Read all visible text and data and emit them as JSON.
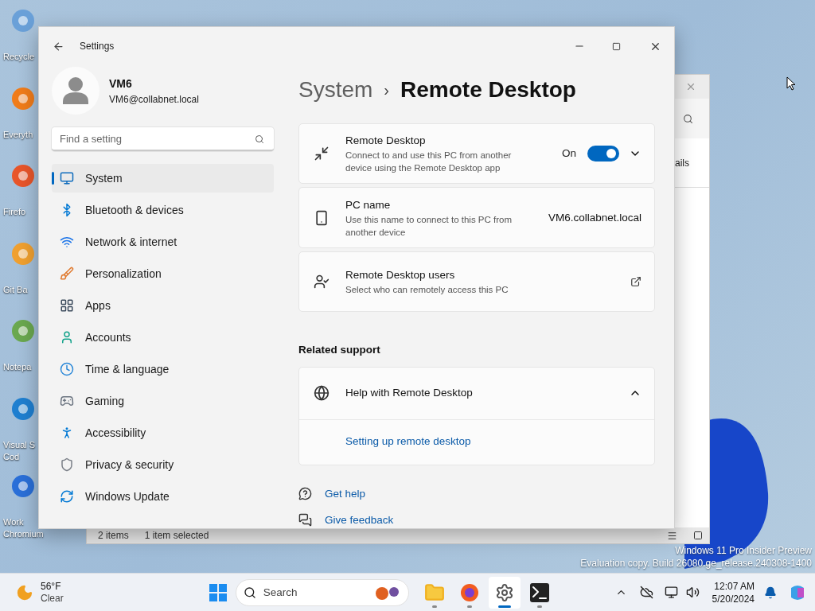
{
  "desktop_icons": [
    {
      "lines": [
        "Recycle"
      ]
    },
    {
      "lines": [
        "Everyth"
      ]
    },
    {
      "lines": [
        "Firefo"
      ]
    },
    {
      "lines": [
        "Git Ba"
      ]
    },
    {
      "lines": [
        "Notepa"
      ]
    },
    {
      "lines": [
        "Visual S",
        "Cod"
      ]
    },
    {
      "lines": [
        "Work",
        "Chromium"
      ]
    }
  ],
  "background_window": {
    "partial_label": "ails",
    "status_bar": [
      "2 items",
      "1 item selected"
    ]
  },
  "settings": {
    "title": "Settings",
    "user": {
      "name": "VM6",
      "email": "VM6@collabnet.local"
    },
    "search": {
      "placeholder": "Find a setting"
    },
    "nav": [
      {
        "label": "System",
        "selected": true
      },
      {
        "label": "Bluetooth & devices",
        "selected": false
      },
      {
        "label": "Network & internet",
        "selected": false
      },
      {
        "label": "Personalization",
        "selected": false
      },
      {
        "label": "Apps",
        "selected": false
      },
      {
        "label": "Accounts",
        "selected": false
      },
      {
        "label": "Time & language",
        "selected": false
      },
      {
        "label": "Gaming",
        "selected": false
      },
      {
        "label": "Accessibility",
        "selected": false
      },
      {
        "label": "Privacy & security",
        "selected": false
      },
      {
        "label": "Windows Update",
        "selected": false
      }
    ],
    "breadcrumb": [
      "System",
      "›",
      "Remote Desktop"
    ],
    "cards": [
      {
        "kind": "toggle",
        "title": "Remote Desktop",
        "description": "Connect to and use this PC from another device using the Remote Desktop app",
        "state_label": "On",
        "on": true,
        "expanded": false
      },
      {
        "kind": "value",
        "title": "PC name",
        "description": "Use this name to connect to this PC from another device",
        "value": "VM6.collabnet.local"
      },
      {
        "kind": "link",
        "title": "Remote Desktop users",
        "description": "Select who can remotely access this PC"
      }
    ],
    "related_heading": "Related support",
    "help": {
      "title": "Help with Remote Desktop",
      "expanded": true,
      "links": [
        "Setting up remote desktop"
      ]
    },
    "footer_links": [
      "Get help",
      "Give feedback"
    ]
  },
  "watermark": [
    "Windows 11 Pro Insider Preview",
    "Evaluation copy. Build 26080.ge_release.240308-1400"
  ],
  "taskbar": {
    "weather": {
      "temp": "56°F",
      "condition": "Clear"
    },
    "search_placeholder": "Search",
    "apps": [
      {
        "selected": false
      },
      {
        "selected": false
      },
      {
        "selected": true
      },
      {
        "selected": false
      }
    ],
    "time": "12:07 AM",
    "date": "5/20/2024"
  }
}
